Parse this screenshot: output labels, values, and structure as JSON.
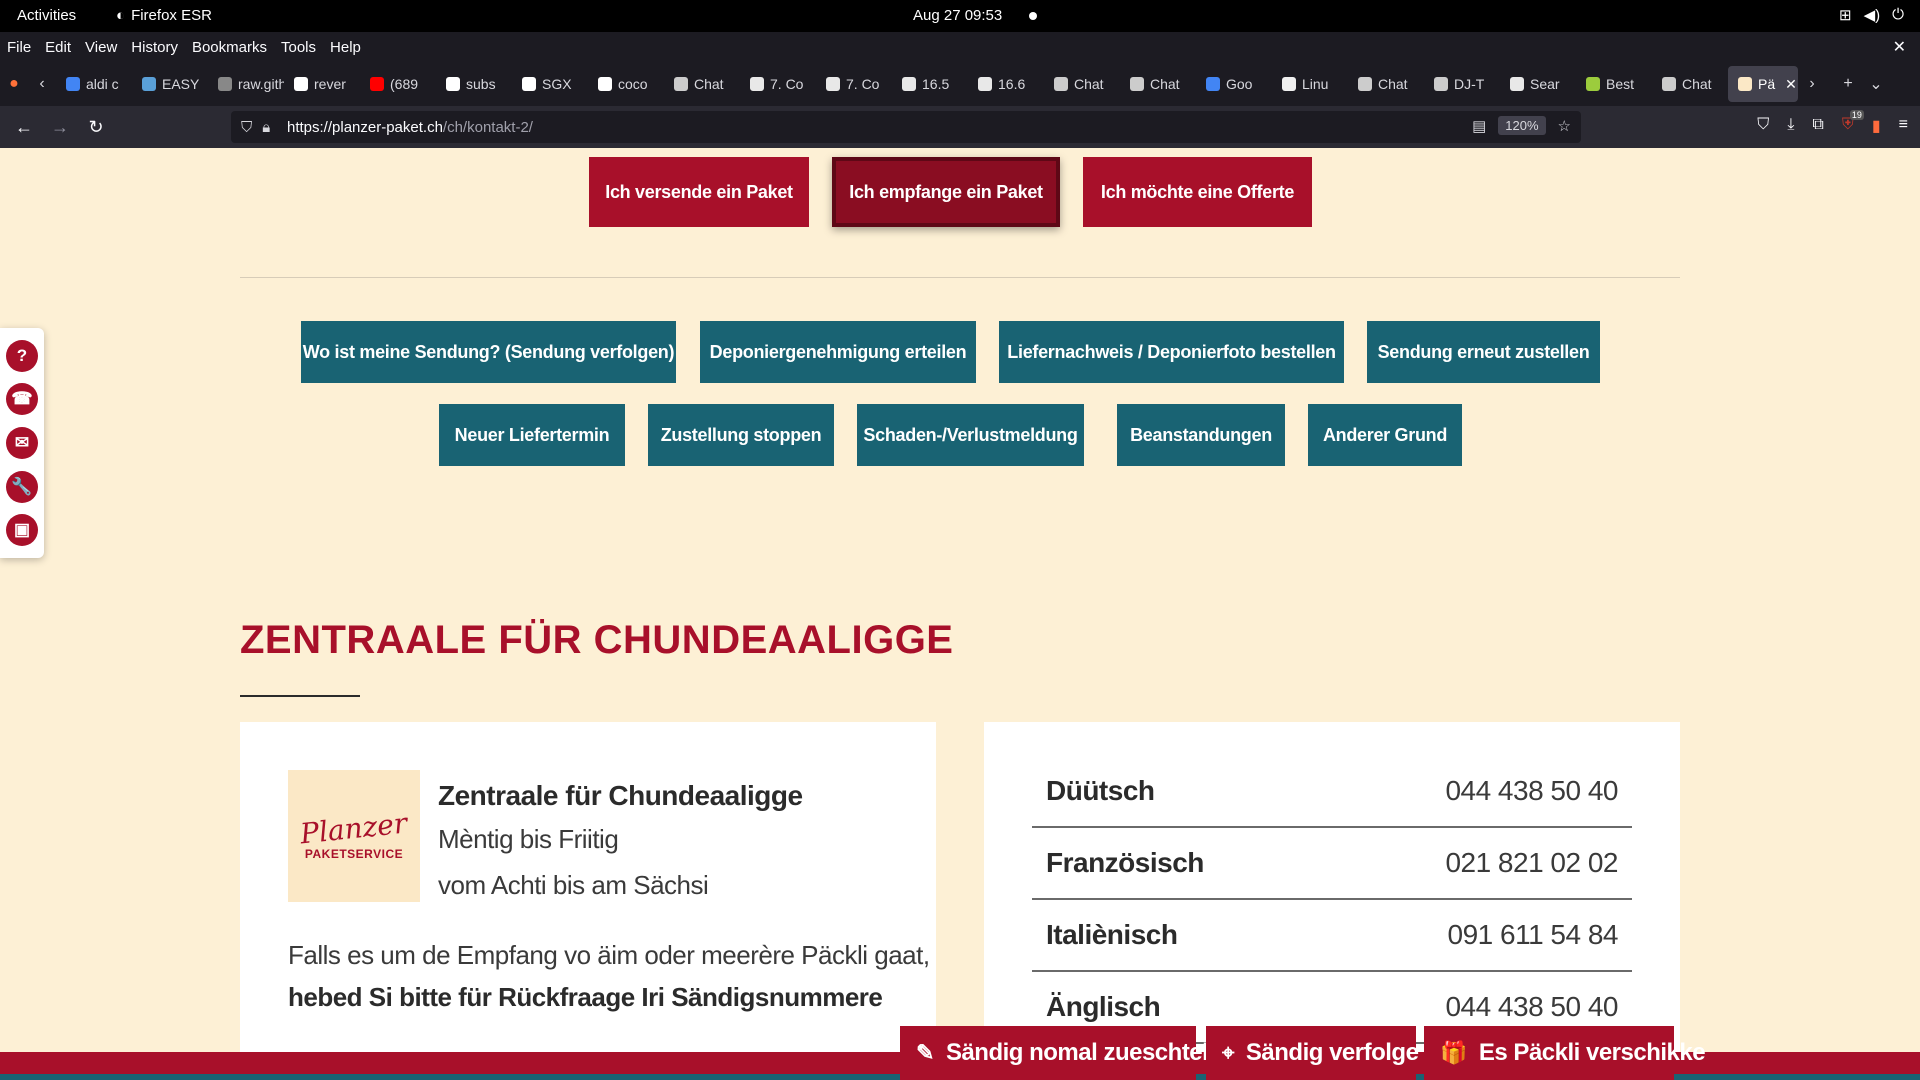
{
  "system_bar": {
    "activities": "Activities",
    "app_name": "Firefox ESR",
    "clock": "Aug 27  09:53"
  },
  "browser": {
    "menu": [
      "File",
      "Edit",
      "View",
      "History",
      "Bookmarks",
      "Tools",
      "Help"
    ],
    "tabs": [
      {
        "label": "aldi c",
        "color": "#4285f4"
      },
      {
        "label": "EASY",
        "color": "#5aa0d8"
      },
      {
        "label": "raw.gith",
        "color": "#888888"
      },
      {
        "label": "rever",
        "color": "#ffffff"
      },
      {
        "label": "(689",
        "color": "#ff0000"
      },
      {
        "label": "subs",
        "color": "#ffffff"
      },
      {
        "label": "SGX",
        "color": "#ffffff"
      },
      {
        "label": "coco",
        "color": "#ffffff"
      },
      {
        "label": "Chat",
        "color": "#cccccc"
      },
      {
        "label": "7. Co",
        "color": "#e8e8e8"
      },
      {
        "label": "7. Co",
        "color": "#e8e8e8"
      },
      {
        "label": "16.5",
        "color": "#e8e8e8"
      },
      {
        "label": "16.6",
        "color": "#e8e8e8"
      },
      {
        "label": "Chat",
        "color": "#cccccc"
      },
      {
        "label": "Chat",
        "color": "#cccccc"
      },
      {
        "label": "Goo",
        "color": "#4285f4"
      },
      {
        "label": "Linu",
        "color": "#f0f0f0"
      },
      {
        "label": "Chat",
        "color": "#cccccc"
      },
      {
        "label": "DJ-T",
        "color": "#cccccc"
      },
      {
        "label": "Sear",
        "color": "#e8e8e8"
      },
      {
        "label": "Best",
        "color": "#9ccc3d"
      },
      {
        "label": "Chat",
        "color": "#cccccc"
      }
    ],
    "active_tab": {
      "label": "Pä",
      "color": "#fbe8c6"
    },
    "url_host": "https://planzer-paket.ch",
    "url_path": "/ch/kontakt-2/",
    "zoom": "120%",
    "extension_badge": "19"
  },
  "page": {
    "top_buttons": [
      {
        "label": "Ich versende ein Paket",
        "selected": false
      },
      {
        "label": "Ich empfange ein Paket",
        "selected": true
      },
      {
        "label": "Ich möchte eine Offerte",
        "selected": false
      }
    ],
    "topic_row1": [
      "Wo ist meine Sendung? (Sendung verfolgen)",
      "Deponiergenehmigung erteilen",
      "Liefernachweis / Deponierfoto bestellen",
      "Sendung erneut zustellen"
    ],
    "topic_row2": [
      "Neuer Liefertermin",
      "Zustellung stoppen",
      "Schaden-/Verlustmeldung",
      "Beanstandungen",
      "Anderer Grund"
    ],
    "side_icons": [
      "?",
      "☎",
      "✉",
      "🔧",
      "▣"
    ],
    "heading": "Zentraale für Chundeaaligge",
    "contact_card": {
      "logo_script": "Planzer",
      "logo_sub": "PAKETSERVICE",
      "title": "Zentraale für Chundeaaligge",
      "hours_days": "Mèntig bis Friitig",
      "hours_time": "vom Achti bis am Sächsi",
      "paragraph": "Falls es um de Empfang vo äim oder meerère Päckli gaat,",
      "paragraph_bold": "hebed Si bitte für Rückfraage Iri Sändigsnummere"
    },
    "phone_numbers": [
      {
        "language": "Düütsch",
        "number": "044 438 50 40"
      },
      {
        "language": "Französisch",
        "number": "021 821 02 02"
      },
      {
        "language": "Italiènisch",
        "number": "091 611 54 84"
      },
      {
        "language": "Änglisch",
        "number": "044 438 50 40"
      }
    ],
    "bottom_buttons": [
      {
        "label": "Sändig nomal zueschtele",
        "icon": "✎"
      },
      {
        "label": "Sändig verfolge",
        "icon": "⌖"
      },
      {
        "label": "Es Päckli verschikke",
        "icon": "🎁"
      }
    ],
    "colors": {
      "brand_red": "#a8102a",
      "teal": "#196373",
      "background": "#fdf0d5"
    }
  }
}
